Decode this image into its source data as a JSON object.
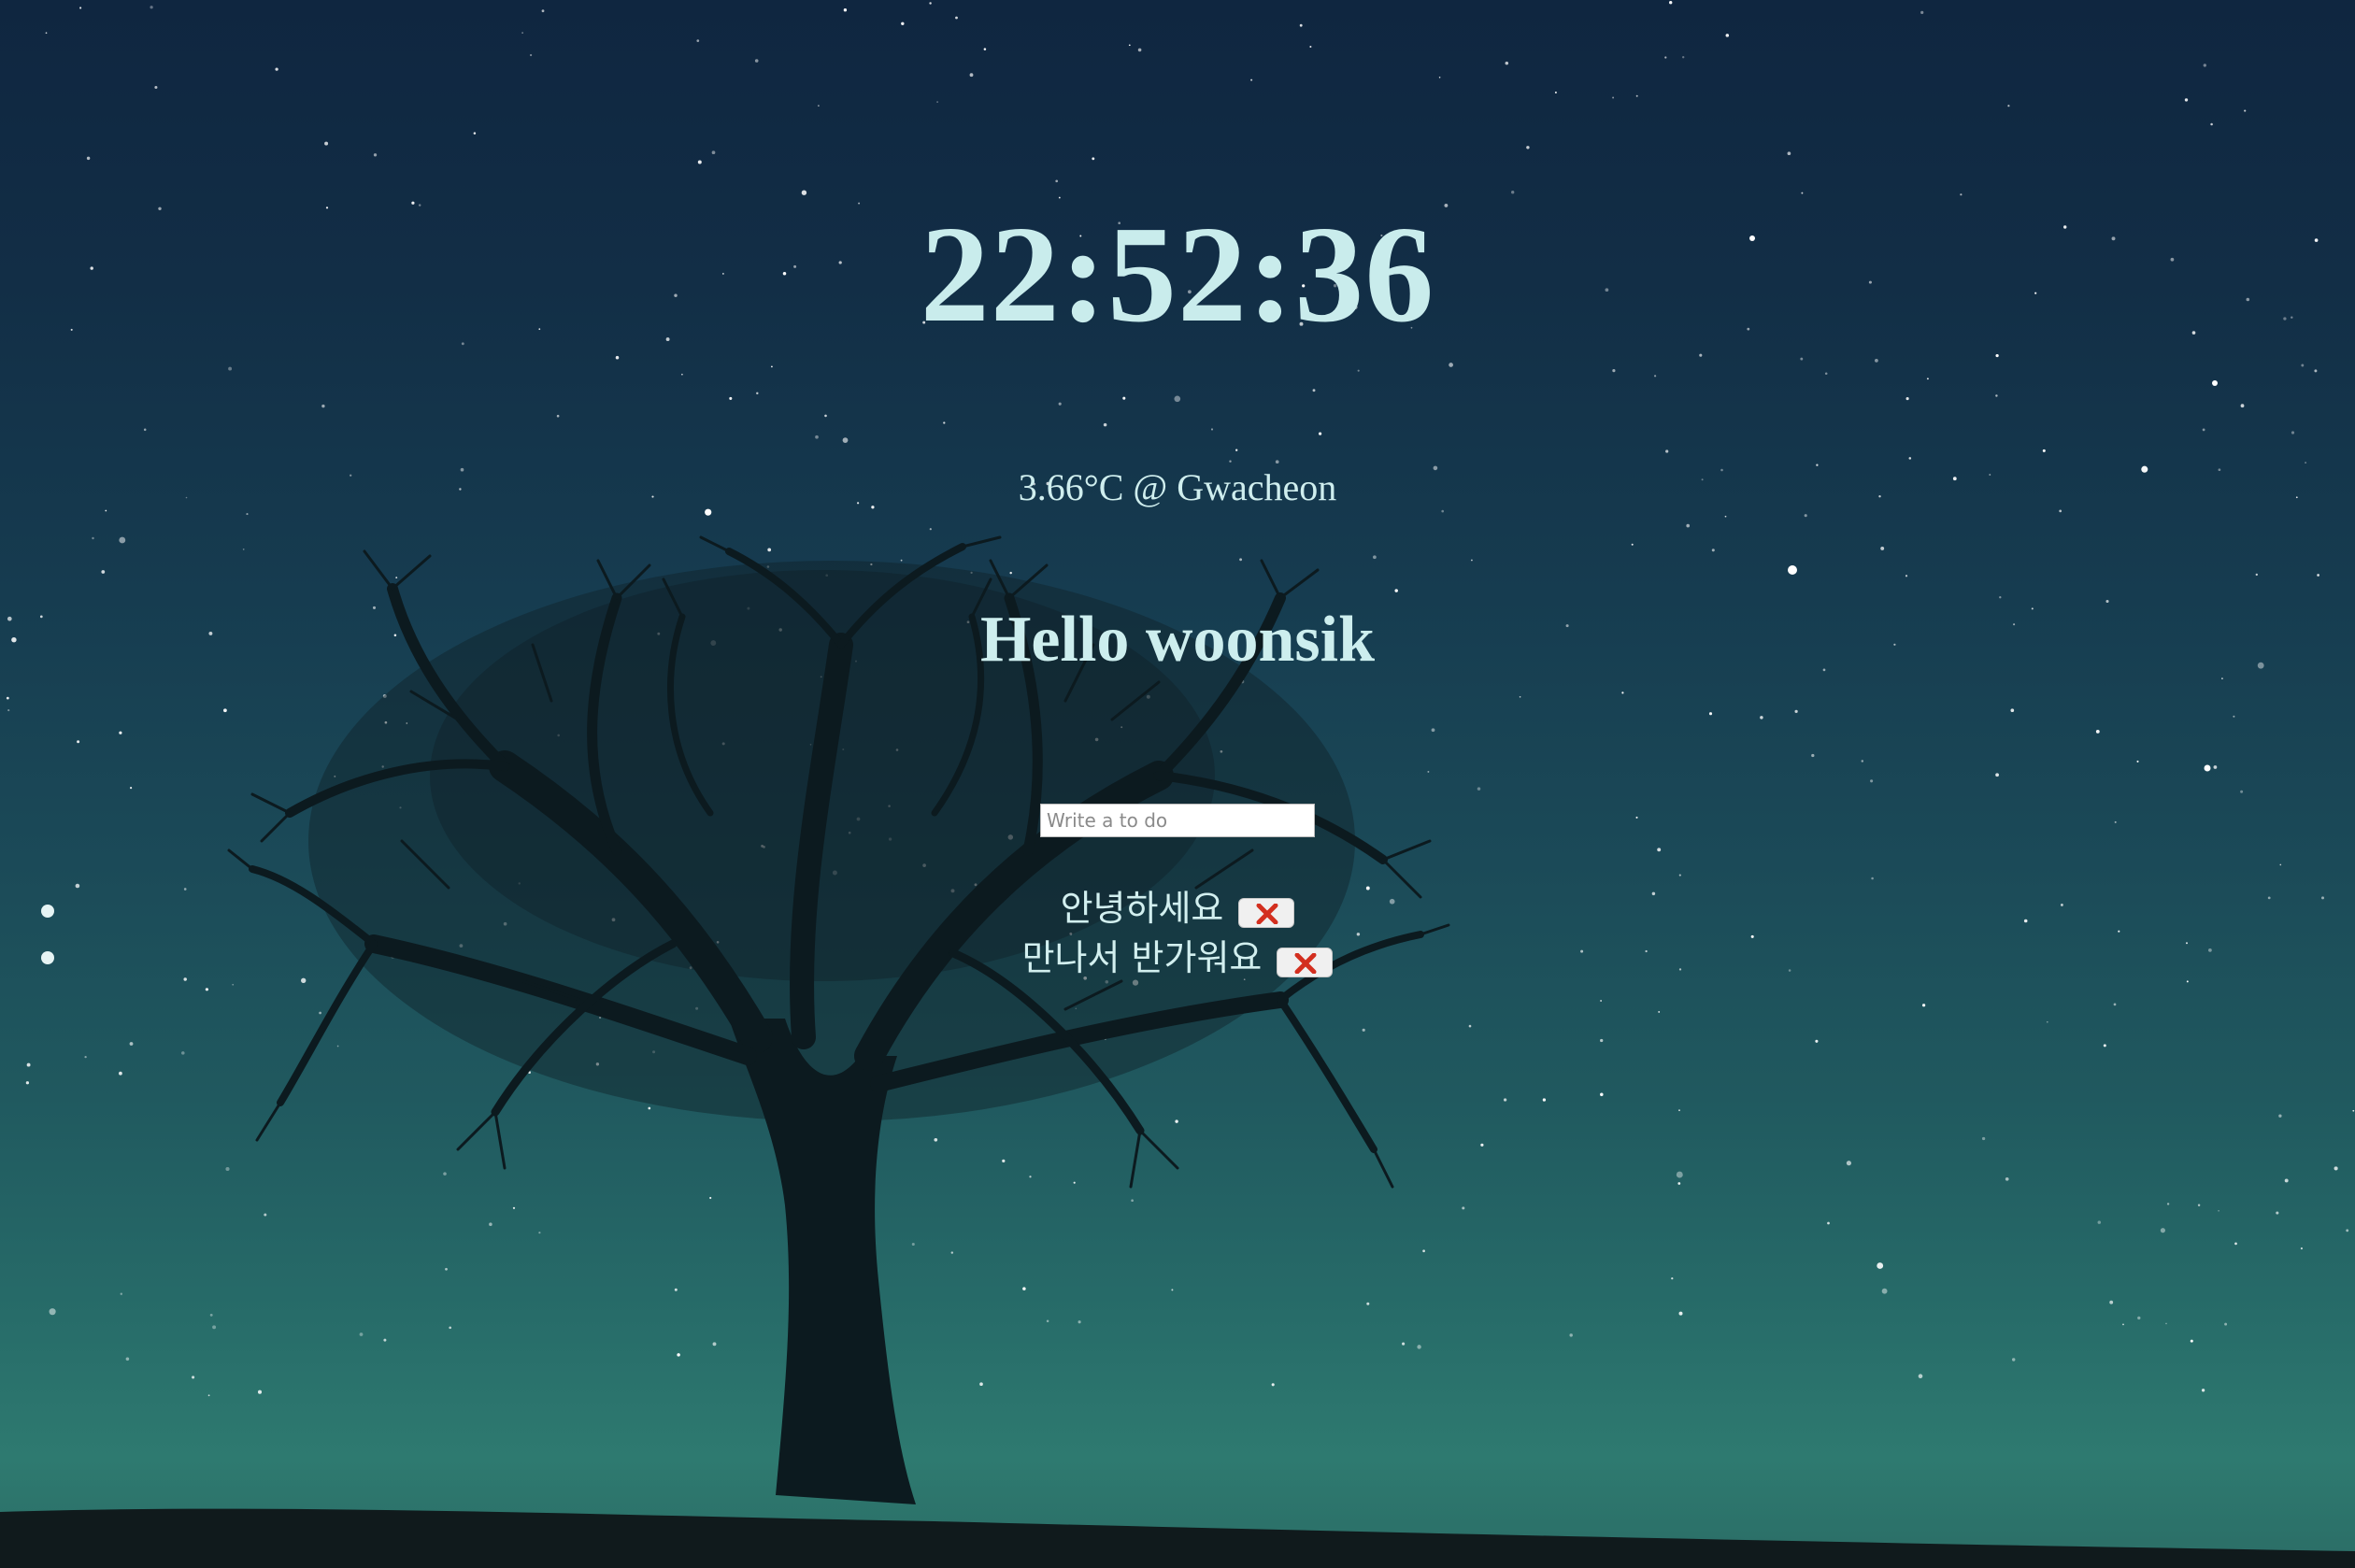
{
  "clock": {
    "time": "22:52:36"
  },
  "weather": {
    "text": "3.66°C @ Gwacheon"
  },
  "greeting": {
    "text": "Hello woonsik"
  },
  "todo": {
    "placeholder": "Write a to do",
    "value": "",
    "items": [
      {
        "text": "안녕하세요",
        "delete_icon": "cross-mark-icon"
      },
      {
        "text": "만나서 반가워요",
        "delete_icon": "cross-mark-icon"
      }
    ]
  },
  "side_indicators": {
    "count": 2
  },
  "colors": {
    "text": "#cdeeee",
    "sky_top": "#0f2640",
    "sky_bottom": "#2e7a70",
    "delete_cross": "#d32f1f"
  }
}
